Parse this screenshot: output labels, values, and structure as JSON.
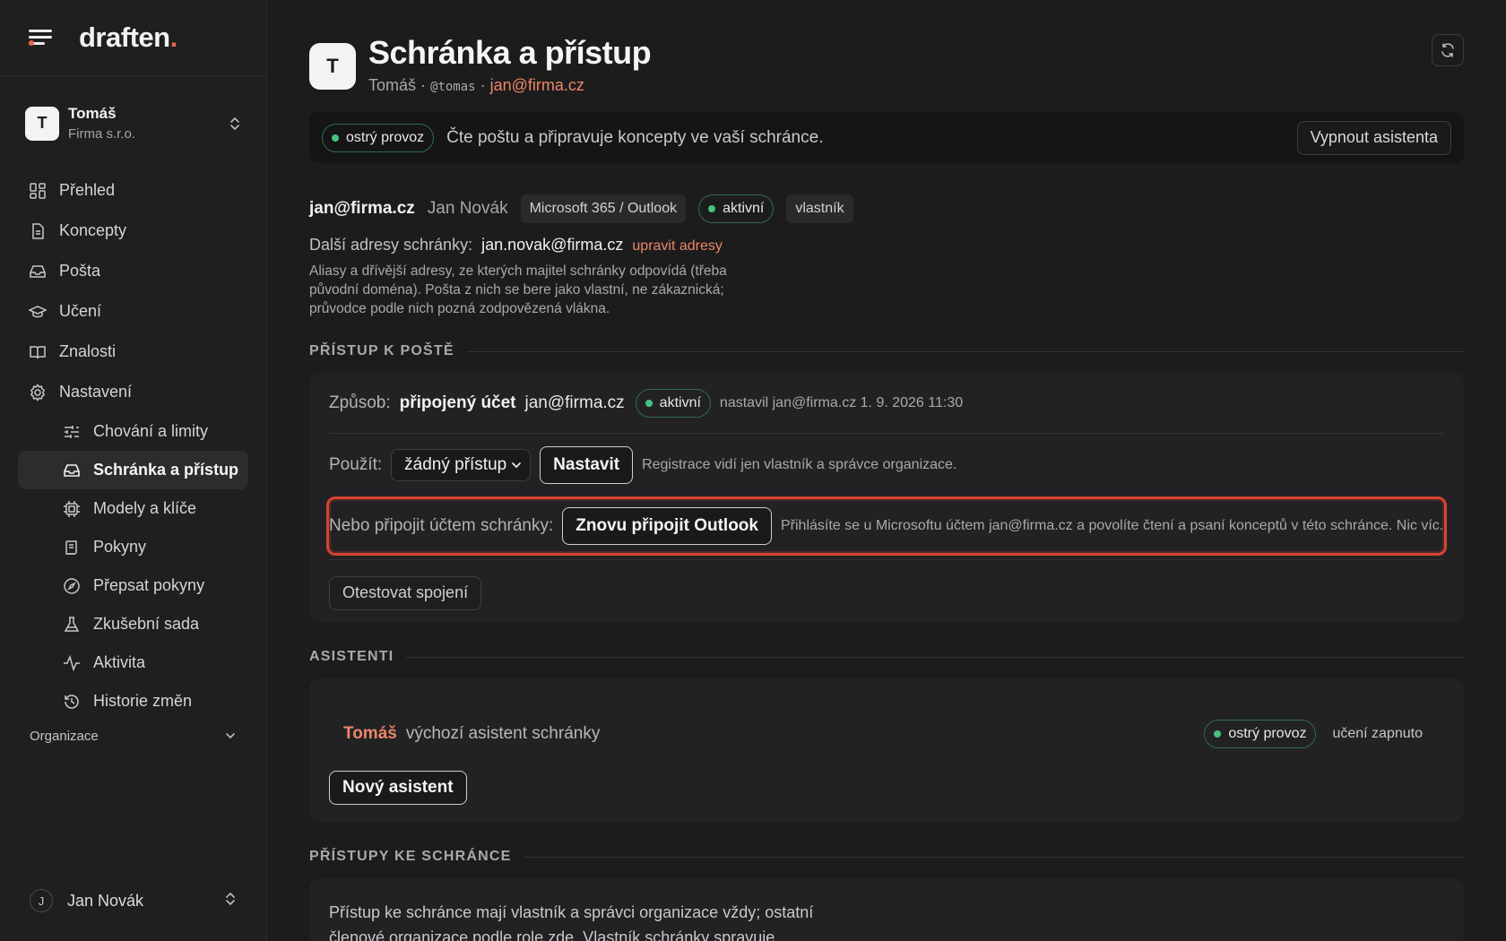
{
  "brand": {
    "name": "draften",
    "dot": "."
  },
  "account": {
    "initial": "T",
    "name": "Tomáš",
    "org": "Firma s.r.o."
  },
  "nav": {
    "overview": "Přehled",
    "drafts": "Koncepty",
    "mail": "Pošta",
    "learning": "Učení",
    "knowledge": "Znalosti",
    "settings": "Nastavení",
    "sub": {
      "behavior": "Chování a limity",
      "mailbox": "Schránka a přístup",
      "models": "Modely a klíče",
      "instructions": "Pokyny",
      "rewrite": "Přepsat pokyny",
      "testset": "Zkušební sada",
      "activity": "Aktivita",
      "history": "Historie změn"
    },
    "organization": "Organizace"
  },
  "user": {
    "initial": "J",
    "name": "Jan Novák"
  },
  "header": {
    "initial": "T",
    "title": "Schránka a přístup",
    "sub_name": "Tomáš",
    "sub_sep1": " · ",
    "sub_handle": "@tomas",
    "sub_sep2": " · ",
    "sub_email": "jan@firma.cz"
  },
  "status": {
    "pill": "ostrý provoz",
    "text": "Čte poštu a připravuje koncepty ve vaší schránce.",
    "button": "Vypnout asistenta"
  },
  "mailbox": {
    "email": "jan@firma.cz",
    "owner": "Jan Novák",
    "provider": "Microsoft 365 / Outlook",
    "state": "aktivní",
    "role": "vlastník",
    "alias_label": "Další adresy schránky:",
    "alias_value": "jan.novak@firma.cz",
    "alias_link": "upravit adresy",
    "alias_desc": "Aliasy a dřívější adresy, ze kterých majitel schránky odpovídá (třeba původní doména). Pošta z nich se bere jako vlastní, ne zákaznická; průvodce podle nich pozná zodpovězená vlákna."
  },
  "access": {
    "section": "PŘÍSTUP K POŠTĚ",
    "way_label": "Způsob:",
    "way_value": "připojený účet",
    "way_email": "jan@firma.cz",
    "way_state": "aktivní",
    "way_meta": "nastavil jan@firma.cz 1. 9. 2026 11:30",
    "use_label": "Použít:",
    "use_selected": "žádný přístup",
    "use_button": "Nastavit",
    "use_hint": "Registrace vidí jen vlastník a správce organizace.",
    "connect_label": "Nebo připojit účtem schránky:",
    "connect_button": "Znovu připojit Outlook",
    "connect_hint": "Přihlásíte se u Microsoftu účtem jan@firma.cz a povolíte čtení a psaní konceptů v této schránce. Nic víc.",
    "test_button": "Otestovat spojení"
  },
  "assistants": {
    "section": "ASISTENTI",
    "name": "Tomáš",
    "desc": "výchozí asistent schránky",
    "pill": "ostrý provoz",
    "learning": "učení zapnuto",
    "new_button": "Nový asistent"
  },
  "mailbox_access": {
    "section": "PŘÍSTUPY KE SCHRÁNCE",
    "text": "Přístup ke schránce mají vlastník a správci organizace vždy; ostatní členové organizace podle role zde. Vlastník schránky spravuje"
  },
  "colors": {
    "accent": "#e8664e",
    "link": "#ec8668",
    "success": "#45c27e",
    "highlight": "#d7432f"
  }
}
